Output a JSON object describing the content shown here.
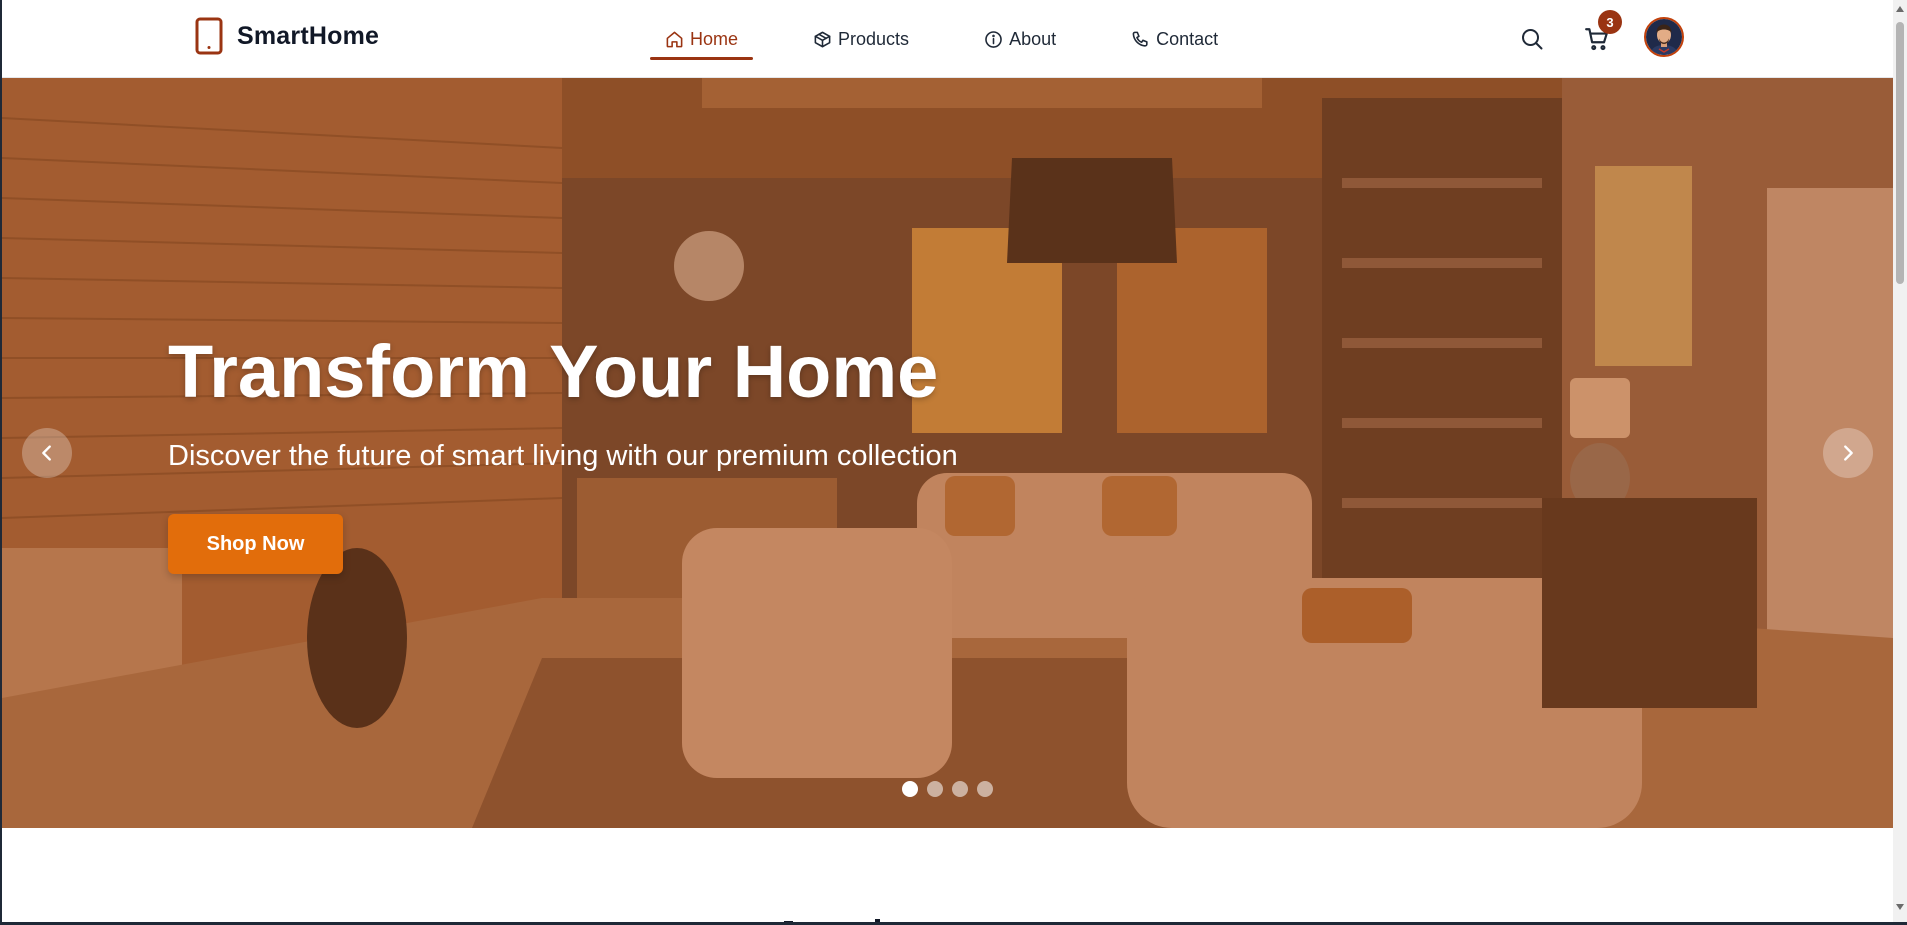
{
  "header": {
    "brand": "SmartHome",
    "nav": [
      {
        "label": "Home",
        "icon": "home-icon",
        "active": true
      },
      {
        "label": "Products",
        "icon": "box-icon",
        "active": false
      },
      {
        "label": "About",
        "icon": "info-icon",
        "active": false
      },
      {
        "label": "Contact",
        "icon": "phone-icon",
        "active": false
      }
    ],
    "cart_count": "3"
  },
  "hero": {
    "title": "Transform Your Home",
    "subtitle": "Discover the future of smart living with our premium collection",
    "cta_label": "Shop Now",
    "slide_count": 4,
    "active_slide": 1
  },
  "colors": {
    "accent": "#9a3412",
    "button": "#e26d0b",
    "overlay": "#b4602a"
  }
}
